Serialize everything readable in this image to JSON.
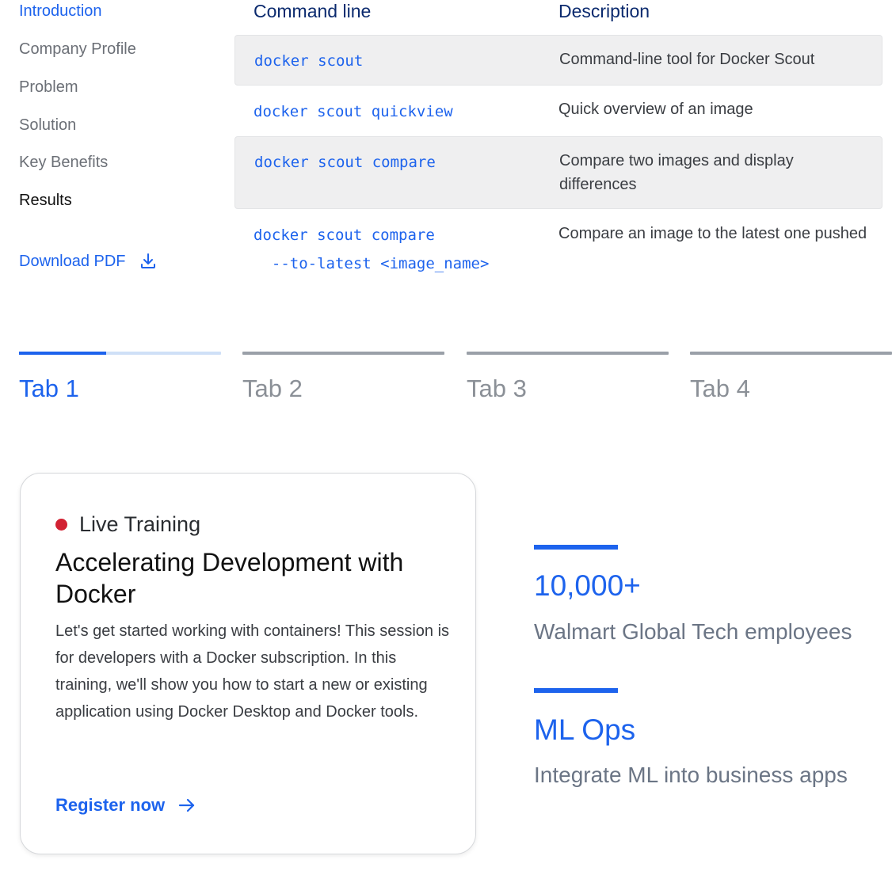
{
  "sidebar": {
    "items": [
      {
        "label": "Introduction"
      },
      {
        "label": "Company Profile"
      },
      {
        "label": "Problem"
      },
      {
        "label": "Solution"
      },
      {
        "label": "Key Benefits"
      },
      {
        "label": "Results"
      }
    ],
    "download_label": "Download PDF"
  },
  "table": {
    "headers": {
      "command": "Command line",
      "description": "Description"
    },
    "rows": [
      {
        "command": "docker scout",
        "description": "Command-line tool for Docker Scout"
      },
      {
        "command": "docker scout quickview",
        "description": "Quick overview of an image"
      },
      {
        "command": "docker scout compare",
        "description": "Compare two images and display differences"
      },
      {
        "command": "docker scout compare\n  --to-latest <image_name>",
        "description": "Compare an image to the latest one pushed"
      }
    ]
  },
  "tabs": [
    {
      "label": "Tab 1",
      "progress": 0.43
    },
    {
      "label": "Tab 2"
    },
    {
      "label": "Tab 3"
    },
    {
      "label": "Tab 4"
    }
  ],
  "card": {
    "badge": "Live Training",
    "title": "Accelerating Development with Docker",
    "body": "Let's get started working with containers! This session is for developers with a Docker subscription. In this training, we'll show you how to start a new or existing application using Docker Desktop and Docker tools.",
    "cta": "Register now"
  },
  "stats": [
    {
      "value": "10,000+",
      "label": "Walmart Global Tech employees"
    },
    {
      "value": "ML Ops",
      "label": "Integrate ML into business apps"
    }
  ],
  "colors": {
    "accent": "#1d63ed",
    "live_dot": "#d22233",
    "header": "#0b2a6e"
  }
}
